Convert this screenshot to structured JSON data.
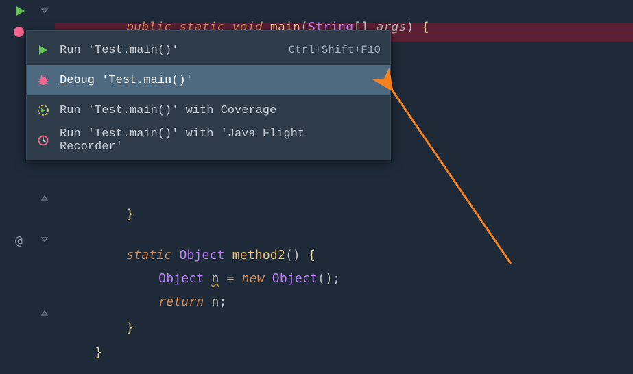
{
  "code": {
    "line1": {
      "modifiers": "public static void",
      "method": "main",
      "open_paren": "(",
      "param_type": "String",
      "brackets": "[]",
      "param_name": "args",
      "close_paren": ")",
      "brace": "{"
    },
    "line_partial_brace": "}",
    "method2": {
      "modifiers": "static",
      "return_type": "Object",
      "name": "method2",
      "parens": "()",
      "brace": "{"
    },
    "body1": {
      "type": "Object",
      "var": "n",
      "eq": "=",
      "new_kw": "new",
      "ctor": "Object",
      "parens": "();"
    },
    "body2": {
      "return_kw": "return",
      "var": "n",
      "semi": ";"
    },
    "close_brace1": "}",
    "close_brace2": "}"
  },
  "gutter": {
    "at": "@"
  },
  "menu": {
    "items": [
      {
        "label": "Run 'Test.main()'",
        "shortcut": "Ctrl+Shift+F10",
        "icon": "run-icon",
        "selected": false
      },
      {
        "label_pre": "",
        "underline": "D",
        "label_post": "ebug 'Test.main()'",
        "shortcut": "",
        "icon": "bug-icon",
        "selected": true
      },
      {
        "label_pre": "Run 'Test.main()' with Co",
        "underline": "v",
        "label_post": "erage",
        "shortcut": "",
        "icon": "coverage-icon",
        "selected": false
      },
      {
        "label_pre": "Run 'Test.main()' with 'Java Flight Recorder'",
        "underline": "",
        "label_post": "",
        "shortcut": "",
        "icon": "jfr-icon",
        "selected": false
      }
    ]
  }
}
